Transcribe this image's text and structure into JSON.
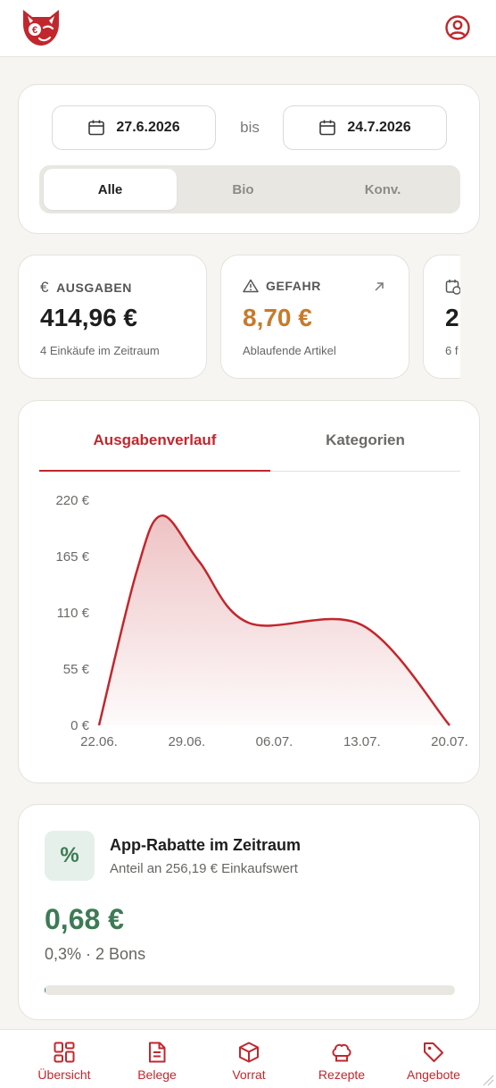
{
  "filters": {
    "date_from": "27.6.2026",
    "date_to": "24.7.2026",
    "range_word": "bis",
    "segments": [
      "Alle",
      "Bio",
      "Konv."
    ],
    "active_segment": "Alle"
  },
  "stats": [
    {
      "label": "AUSGABEN",
      "value": "414,96 €",
      "sub": "4 Einkäufe im Zeitraum",
      "icon": "euro-icon",
      "color": "#1e1e1e"
    },
    {
      "label": "GEFAHR",
      "value": "8,70 €",
      "sub": "Ablaufende Artikel",
      "icon": "warning-icon",
      "color": "#c87a2a"
    },
    {
      "label": "",
      "value": "2",
      "sub": "6 f",
      "icon": "calendar-clock-icon",
      "color": "#1e1e1e"
    }
  ],
  "chart_tabs": {
    "active": "Ausgabenverlauf",
    "other": "Kategorien"
  },
  "chart_data": {
    "type": "area",
    "x": [
      "22.06.",
      "25.06.",
      "27.06.",
      "30.06.",
      "04.07.",
      "13.07.",
      "20.07."
    ],
    "values": [
      0,
      150,
      205,
      160,
      100,
      98,
      0
    ],
    "x_ticks": [
      "22.06.",
      "29.06.",
      "06.07.",
      "13.07.",
      "20.07."
    ],
    "y_ticks": [
      "0 €",
      "55 €",
      "110 €",
      "165 €",
      "220 €"
    ],
    "ylim": [
      0,
      220
    ],
    "grid": false,
    "line_color": "#c1272d"
  },
  "rabatt": {
    "title": "App-Rabatte im Zeitraum",
    "subtitle": "Anteil an 256,19 € Einkaufswert",
    "value": "0,68 €",
    "meta": "0,3% · 2 Bons",
    "progress_percent": 0.3,
    "symbol": "%"
  },
  "nav": [
    {
      "label": "Übersicht",
      "icon": "grid-icon"
    },
    {
      "label": "Belege",
      "icon": "receipt-icon"
    },
    {
      "label": "Vorrat",
      "icon": "box-icon"
    },
    {
      "label": "Rezepte",
      "icon": "chef-hat-icon"
    },
    {
      "label": "Angebote",
      "icon": "tag-icon"
    }
  ],
  "colors": {
    "accent": "#c1272d",
    "success": "#3d7a55",
    "warning": "#c87a2a",
    "background": "#f6f5f1"
  }
}
